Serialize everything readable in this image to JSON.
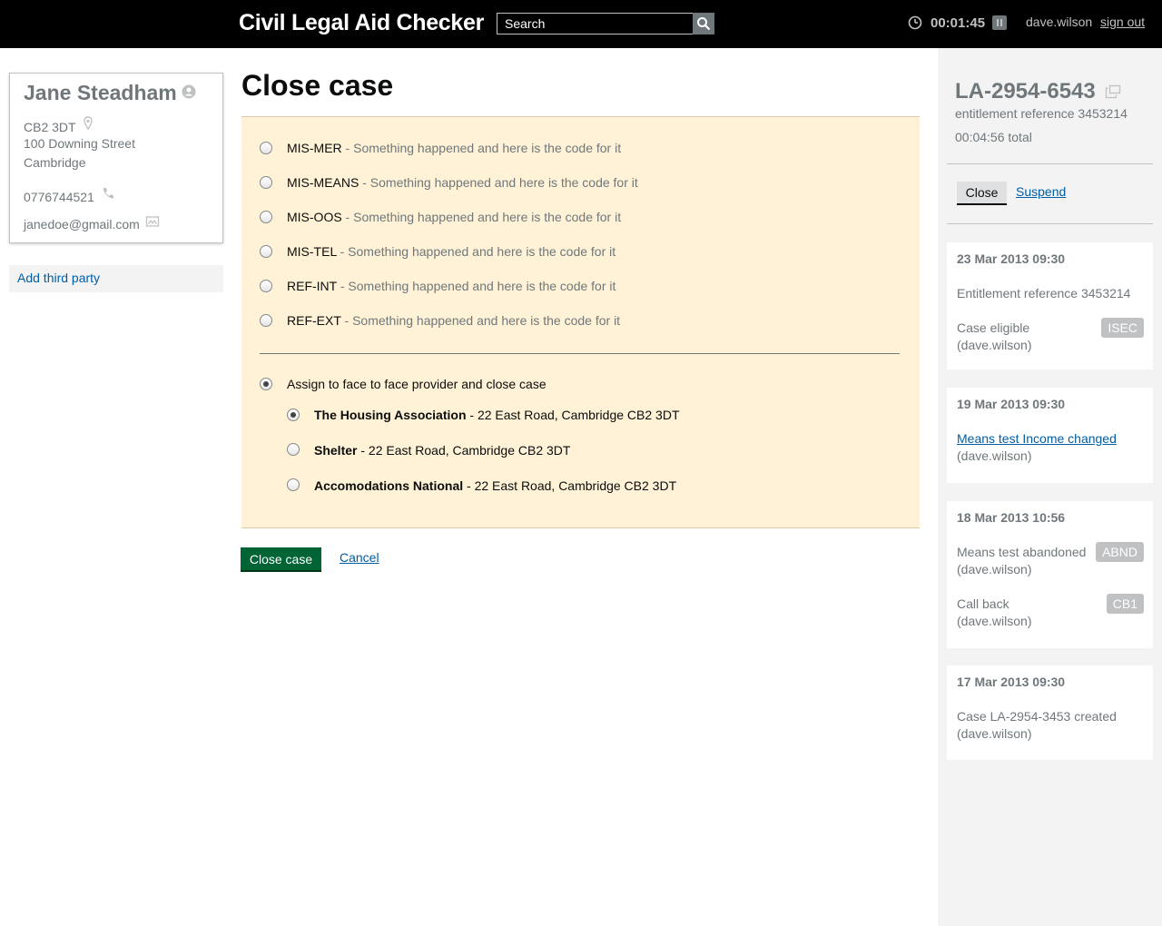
{
  "header": {
    "app_title": "Civil Legal Aid Checker",
    "search_placeholder": "Search",
    "timer": "00:01:45",
    "username": "dave.wilson",
    "signout": "sign out"
  },
  "client": {
    "name": "Jane Steadham",
    "postcode": "CB2 3DT",
    "address_line1": "100 Downing Street",
    "address_line2": "Cambridge",
    "phone": "0776744521",
    "email": "janedoe@gmail.com",
    "add_third_party": "Add third party"
  },
  "main": {
    "title": "Close case",
    "outcomes": [
      {
        "code": "MIS-MER",
        "desc": " - Something happened and here is the code for it",
        "selected": false
      },
      {
        "code": "MIS-MEANS",
        "desc": " - Something happened and here is the code for it",
        "selected": false
      },
      {
        "code": "MIS-OOS",
        "desc": " - Something happened and here is the code for it",
        "selected": false
      },
      {
        "code": "MIS-TEL",
        "desc": " - Something happened and here is the code for it",
        "selected": false
      },
      {
        "code": "REF-INT",
        "desc": " - Something happened and here is the code for it",
        "selected": false
      },
      {
        "code": "REF-EXT",
        "desc": " - Something happened and here is the code for it",
        "selected": false
      }
    ],
    "assign_label": "Assign to face to face provider and close case",
    "assign_selected": true,
    "providers": [
      {
        "name": "The Housing Association",
        "address": " - 22 East Road, Cambridge CB2 3DT",
        "selected": true
      },
      {
        "name": "Shelter",
        "address": " - 22 East Road, Cambridge CB2 3DT",
        "selected": false
      },
      {
        "name": "Accomodations National",
        "address": " - 22 East Road, Cambridge CB2 3DT",
        "selected": false
      }
    ],
    "close_button": "Close case",
    "cancel_link": "Cancel"
  },
  "sidebar": {
    "case_ref": "LA-2954-6543",
    "entitlement": "entitlement reference 3453214",
    "total": "00:04:56 total",
    "close_button": "Close",
    "suspend_link": "Suspend",
    "events": [
      {
        "date": "23 Mar 2013 09:30",
        "entries": [
          {
            "text": "Entitlement reference 3453214"
          },
          {
            "text": "Case eligible",
            "user": "(dave.wilson)",
            "badge": "ISEC"
          }
        ]
      },
      {
        "date": "19 Mar 2013 09:30",
        "entries": [
          {
            "text": "Means test Income changed",
            "user": "(dave.wilson)"
          }
        ]
      },
      {
        "date": "18 Mar 2013 10:56",
        "entries": [
          {
            "text": "Means test abandoned",
            "user": "(dave.wilson)",
            "badge": "ABND"
          },
          {
            "text": "Call back",
            "user": "(dave.wilson)",
            "badge": "CB1"
          }
        ]
      },
      {
        "date": "17 Mar 2013 09:30",
        "entries": [
          {
            "text": "Case LA-2954-3453 created",
            "user": "(dave.wilson)"
          }
        ]
      }
    ]
  },
  "colors": {
    "panel_bg": "#fff2d6",
    "primary_button": "#006435",
    "link": "#005ea5",
    "badge": "#bfc1c3"
  }
}
